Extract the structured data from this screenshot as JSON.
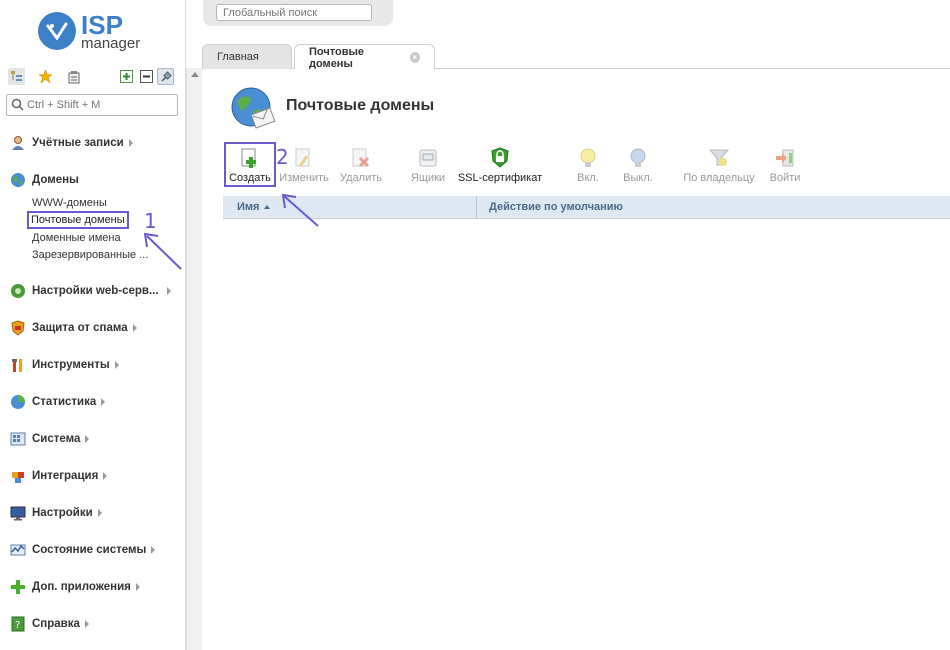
{
  "logo": {
    "brand": "ISP",
    "product": "manager"
  },
  "sidebar": {
    "search_placeholder": "Ctrl + Shift + M",
    "menu": [
      {
        "label": "Учётные записи",
        "icon": "user-icon"
      },
      {
        "label": "Домены",
        "icon": "globe-icon",
        "sub": [
          "WWW-домены",
          "Почтовые домены",
          "Доменные имена",
          "Зарезервированные ..."
        ]
      },
      {
        "label": "Настройки web-серв...",
        "icon": "web-settings-icon"
      },
      {
        "label": "Защита от спама",
        "icon": "spam-shield-icon"
      },
      {
        "label": "Инструменты",
        "icon": "tools-icon"
      },
      {
        "label": "Статистика",
        "icon": "pie-chart-icon"
      },
      {
        "label": "Система",
        "icon": "system-icon"
      },
      {
        "label": "Интеграция",
        "icon": "puzzle-icon"
      },
      {
        "label": "Настройки",
        "icon": "monitor-settings-icon"
      },
      {
        "label": "Состояние системы",
        "icon": "graph-icon"
      },
      {
        "label": "Доп. приложения",
        "icon": "plus-icon"
      },
      {
        "label": "Справка",
        "icon": "help-icon"
      }
    ]
  },
  "top": {
    "global_search_placeholder": "Глобальный поиск"
  },
  "tabs": [
    {
      "label": "Главная",
      "active": false
    },
    {
      "label": "Почтовые домены",
      "active": true
    }
  ],
  "page": {
    "title": "Почтовые домены",
    "toolbar": [
      {
        "label": "Создать",
        "icon": "create-doc-icon",
        "enabled": true
      },
      {
        "label": "Изменить",
        "icon": "edit-doc-icon",
        "enabled": false
      },
      {
        "label": "Удалить",
        "icon": "delete-doc-icon",
        "enabled": false
      },
      {
        "label": "Ящики",
        "icon": "mailbox-icon",
        "enabled": false
      },
      {
        "label": "SSL-сертификат",
        "icon": "ssl-lock-icon",
        "enabled": true
      },
      {
        "label": "Вкл.",
        "icon": "bulb-on-icon",
        "enabled": false
      },
      {
        "label": "Выкл.",
        "icon": "bulb-off-icon",
        "enabled": false
      },
      {
        "label": "По владельцу",
        "icon": "filter-owner-icon",
        "enabled": false
      },
      {
        "label": "Войти",
        "icon": "login-icon",
        "enabled": false
      }
    ],
    "columns": [
      "Имя",
      "Действие по умолчанию"
    ]
  },
  "annotations": [
    "1",
    "2"
  ],
  "colors": {
    "accent": "#3c80c8",
    "annotation": "#6a5acd",
    "grid_header": "#dde8f2"
  }
}
